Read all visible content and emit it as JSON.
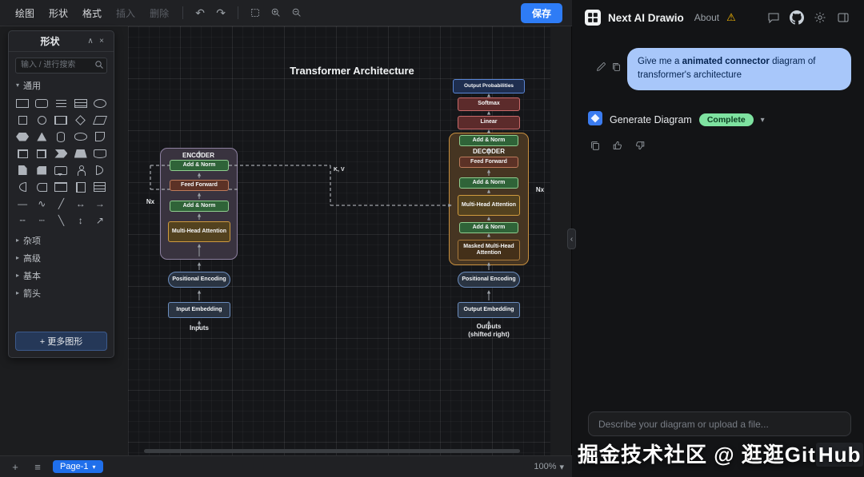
{
  "icons": {
    "undo": "↶",
    "redo": "↷",
    "warning": "⚠",
    "chevron_down": "▾",
    "minimize": "∧",
    "close": "×",
    "plus": "+",
    "pages": "≡",
    "caret_right": "▸",
    "caret_down": "▾",
    "collapse_left": "‹"
  },
  "editor": {
    "menubar": {
      "items": [
        "绘图",
        "形状",
        "格式"
      ],
      "disabled": [
        "插入",
        "删除"
      ],
      "save": "保存"
    },
    "shapes_panel": {
      "title": "形状",
      "search_placeholder": "输入 / 进行搜索",
      "general_section": "通用",
      "collapsed_sections": [
        "杂项",
        "高级",
        "基本",
        "箭头"
      ],
      "more_shapes": "+ 更多图形",
      "shapes": [
        {
          "n": "rectangle",
          "c": "rect"
        },
        {
          "n": "rounded-rectangle",
          "c": "round"
        },
        {
          "n": "text",
          "c": "text"
        },
        {
          "n": "unordered-list",
          "c": "list"
        },
        {
          "n": "ellipse",
          "c": "ellipse"
        },
        {
          "n": "square",
          "c": "square"
        },
        {
          "n": "circle",
          "c": "circle"
        },
        {
          "n": "process",
          "c": "process"
        },
        {
          "n": "diamond",
          "c": "diamond"
        },
        {
          "n": "parallelogram",
          "c": "para"
        },
        {
          "n": "hexagon",
          "c": "hex"
        },
        {
          "n": "triangle",
          "c": "tri"
        },
        {
          "n": "cylinder",
          "c": "cyl"
        },
        {
          "n": "cloud",
          "c": "cloud"
        },
        {
          "n": "document",
          "c": "doc"
        },
        {
          "n": "internal-storage",
          "c": "istore"
        },
        {
          "n": "cube",
          "c": "cube"
        },
        {
          "n": "step",
          "c": "step"
        },
        {
          "n": "trapezoid",
          "c": "trap"
        },
        {
          "n": "tape",
          "c": "tape"
        },
        {
          "n": "note",
          "c": "note"
        },
        {
          "n": "card",
          "c": "card"
        },
        {
          "n": "callout",
          "c": "callout"
        },
        {
          "n": "actor",
          "c": "actor"
        },
        {
          "n": "or",
          "c": "or"
        },
        {
          "n": "and",
          "c": "and"
        },
        {
          "n": "data-storage",
          "c": "dstore"
        },
        {
          "n": "container",
          "c": "cont"
        },
        {
          "n": "vertical-container",
          "c": "vcont"
        },
        {
          "n": "list-box",
          "c": "lbox"
        },
        {
          "n": "line",
          "c": "glyph",
          "g": "—"
        },
        {
          "n": "curve",
          "c": "glyph",
          "g": "∿"
        },
        {
          "n": "diagonal-line",
          "c": "glyph",
          "g": "╱"
        },
        {
          "n": "bidirectional-arrow",
          "c": "glyph",
          "g": "↔"
        },
        {
          "n": "arrow",
          "c": "glyph",
          "g": "→"
        },
        {
          "n": "dashed-line",
          "c": "glyph",
          "g": "╌"
        },
        {
          "n": "dotted-line",
          "c": "glyph",
          "g": "┄"
        },
        {
          "n": "diagonal-line-2",
          "c": "glyph",
          "g": "╲"
        },
        {
          "n": "vertical-arrow",
          "c": "glyph",
          "g": "↕"
        },
        {
          "n": "diagonal-arrow",
          "c": "glyph",
          "g": "↗"
        }
      ]
    },
    "statusbar": {
      "page": "Page-1",
      "zoom": "100%"
    },
    "diagram": {
      "title": "Transformer Architecture",
      "encoder_label": "ENCODER",
      "decoder_label": "DECODER",
      "add_norm": "Add & Norm",
      "feed_forward": "Feed Forward",
      "multi_head_attention": "Multi-Head Attention",
      "masked_multi_head_attention": "Masked Multi-Head Attention",
      "softmax": "Softmax",
      "linear": "Linear",
      "output_probabilities": "Output Probabilities",
      "positional_encoding": "Positional Encoding",
      "input_embedding": "Input Embedding",
      "output_embedding": "Output Embedding",
      "inputs": "Inputs",
      "outputs_line1": "Outputs",
      "outputs_line2": "(shifted right)",
      "kv": "K, V",
      "nx": "Nx"
    }
  },
  "chat": {
    "title": "Next AI Drawio",
    "about": "About",
    "message": {
      "prefix": "Give me a ",
      "bold": "animated connector",
      "suffix": " diagram of transformer's architecture"
    },
    "tool": {
      "label": "Generate Diagram",
      "status": "Complete"
    },
    "composer_placeholder": "Describe your diagram or upload a file..."
  },
  "watermark": {
    "part1": "掘金技术社区 @ 逛逛Git",
    "part2": "Hub"
  }
}
